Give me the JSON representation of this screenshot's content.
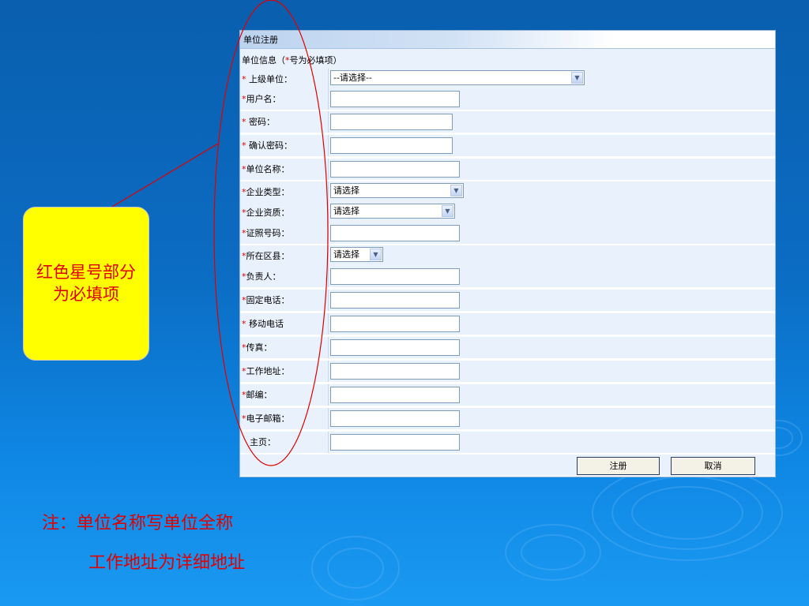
{
  "form": {
    "title": "单位注册",
    "info_prefix": "单位信息（",
    "info_star": "*",
    "info_suffix": "号为必填项）",
    "fields": [
      {
        "label": "上级单位：",
        "star": "* ",
        "type": "select",
        "value": "--请选择--"
      },
      {
        "label": "用户名：",
        "star": "*",
        "type": "text"
      },
      {
        "label": "密码：",
        "star": "* ",
        "type": "password"
      },
      {
        "label": "确认密码：",
        "star": "* ",
        "type": "password"
      },
      {
        "label": "单位名称：",
        "star": "*",
        "type": "text"
      },
      {
        "label": "企业类型：",
        "star": "*",
        "type": "select",
        "value": "请选择"
      },
      {
        "label": "企业资质：",
        "star": "*",
        "type": "select",
        "value": "请选择"
      },
      {
        "label": "证照号码：",
        "star": "*",
        "type": "text"
      },
      {
        "label": "所在区县：",
        "star": "*",
        "type": "select",
        "value": "请选择"
      },
      {
        "label": "负责人：",
        "star": "*",
        "type": "text"
      },
      {
        "label": "固定电话：",
        "star": "*",
        "type": "text"
      },
      {
        "label": "移动电话",
        "star": "* ",
        "type": "text"
      },
      {
        "label": "传真：",
        "star": "*",
        "type": "text"
      },
      {
        "label": "工作地址：",
        "star": "*",
        "type": "text"
      },
      {
        "label": "邮编：",
        "star": "*",
        "type": "text"
      },
      {
        "label": "电子邮箱：",
        "star": "*",
        "type": "text"
      },
      {
        "label": "主页：",
        "star": "",
        "type": "text"
      }
    ],
    "register_label": "注册",
    "cancel_label": "取消"
  },
  "callout": {
    "line1": "红色星号部分",
    "line2": "为必填项"
  },
  "notes": {
    "line1": "注：单位名称写单位全称",
    "line2": "工作地址为详细地址"
  },
  "colors": {
    "accent_red": "#e00000",
    "callout_yellow": "#ffff00",
    "background_blue": "#0b6cc3",
    "row_bg": "#e8f1fc"
  }
}
